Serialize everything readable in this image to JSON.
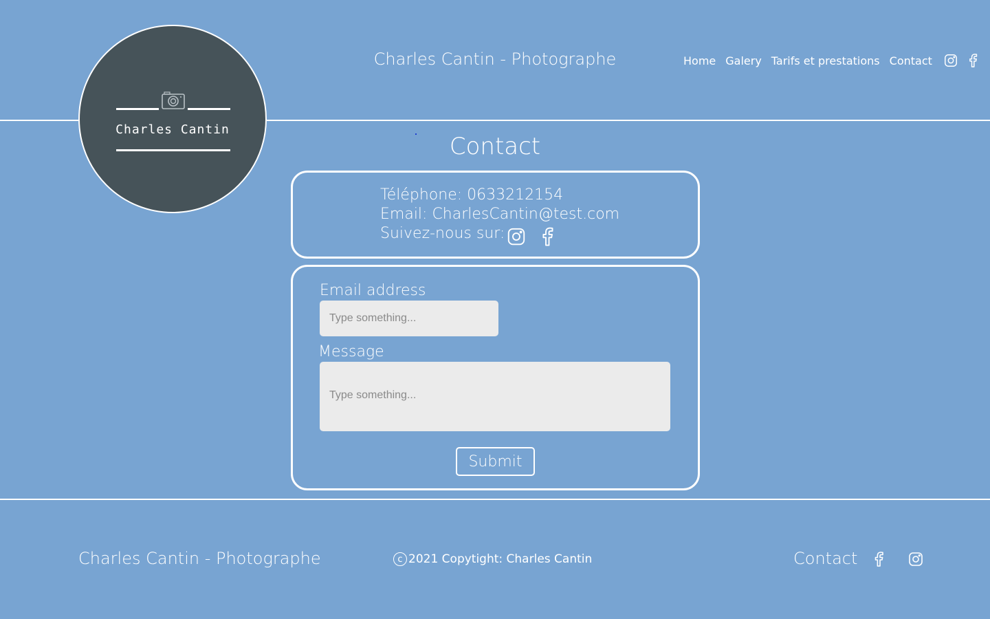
{
  "header": {
    "logo_text": "Charles Cantin",
    "site_title": "Charles Cantin - Photographe",
    "nav": [
      {
        "label": "Home"
      },
      {
        "label": "Galery"
      },
      {
        "label": "Tarifs et prestations"
      },
      {
        "label": "Contact"
      }
    ],
    "icons": [
      "instagram-icon",
      "facebook-icon"
    ]
  },
  "main": {
    "heading": "Contact",
    "info": {
      "phone": "Téléphone: 0633212154",
      "email": "Email: CharlesCantin@test.com",
      "follow": "Suivez-nous sur:"
    },
    "form": {
      "email_label": "Email address",
      "email_placeholder": "Type something...",
      "email_value": "",
      "message_label": "Message",
      "message_placeholder": "Type something...",
      "message_value": "",
      "submit_label": "Submit"
    }
  },
  "footer": {
    "title": "Charles Cantin - Photographe",
    "copyright_symbol": "c",
    "copyright": "2021 Copytight: Charles Cantin",
    "contact_label": "Contact"
  },
  "colors": {
    "background": "#78a4d2",
    "logo_background": "#465359",
    "text": "#ffffff",
    "field_background": "#ebebeb"
  }
}
